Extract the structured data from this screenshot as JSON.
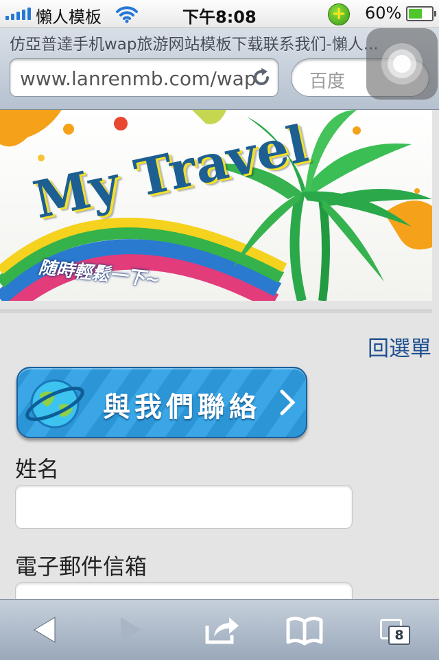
{
  "status_bar": {
    "carrier": "懶人模板",
    "time": "下午8:08",
    "battery_percent": "60%",
    "battery_level": 0.6
  },
  "browser": {
    "page_title": "仿亞普達手机wap旅游网站模板下载联系我们-懶人...",
    "url": "www.lanrenmb.com/wap",
    "search_placeholder": "百度"
  },
  "page": {
    "banner": {
      "title": "My Travel",
      "subtitle": "随時輕鬆一下~"
    },
    "back_link": "回選單",
    "contact_button": "與我們聯絡",
    "form": {
      "name_label": "姓名",
      "name_value": "",
      "email_label": "電子郵件信箱",
      "email_value": ""
    }
  },
  "toolbar": {
    "tab_count": "8"
  },
  "colors": {
    "link": "#1e4f8f",
    "contact_button": "#2c95d6",
    "signal": "#2677d6"
  }
}
